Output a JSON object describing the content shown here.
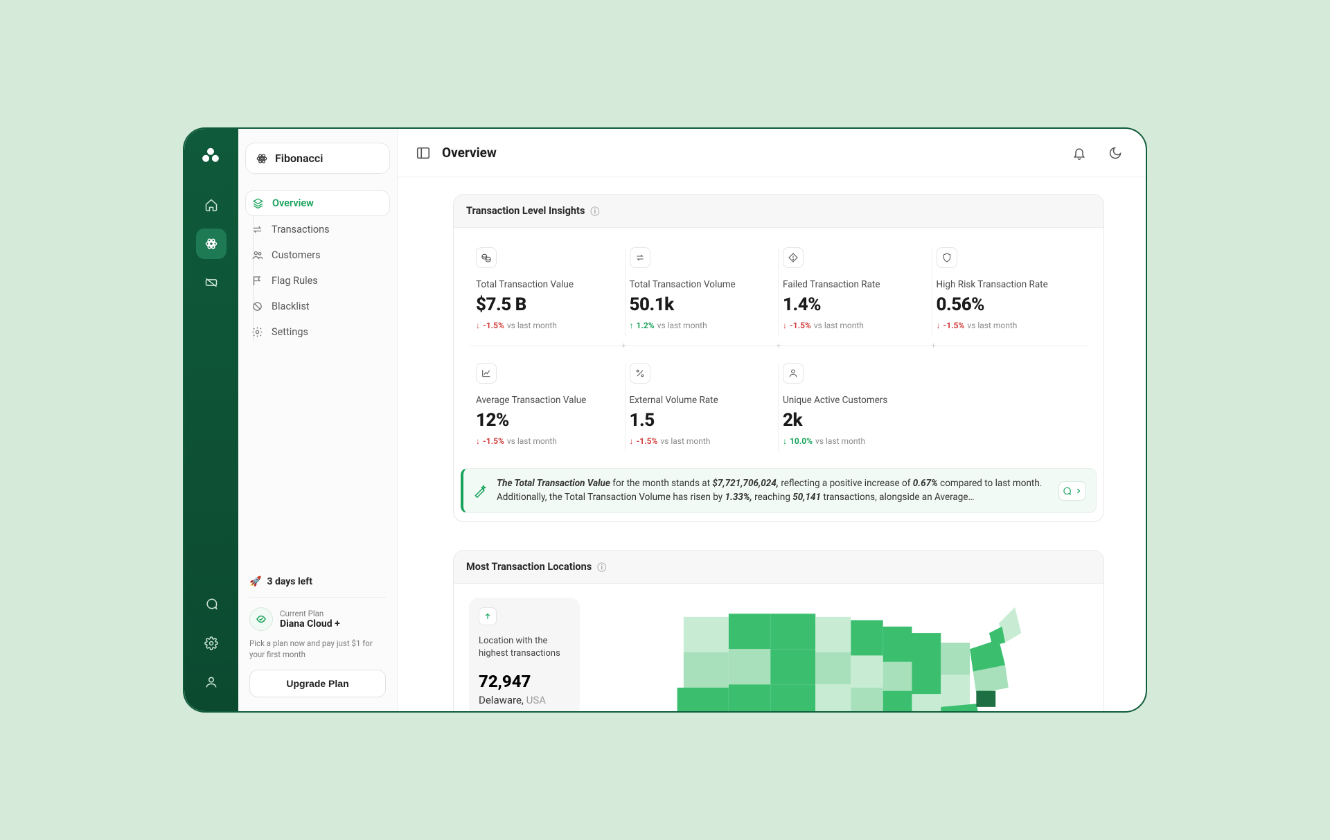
{
  "workspace": {
    "name": "Fibonacci"
  },
  "page": {
    "title": "Overview"
  },
  "sidebar": {
    "items": [
      {
        "label": "Overview"
      },
      {
        "label": "Transactions"
      },
      {
        "label": "Customers"
      },
      {
        "label": "Flag Rules"
      },
      {
        "label": "Blacklist"
      },
      {
        "label": "Settings"
      }
    ]
  },
  "plan": {
    "trial_prefix": "🚀",
    "trial_text": "3 days left",
    "current_label": "Current Plan",
    "current_name": "Diana Cloud +",
    "copy": "Pick a plan now and pay just $1 for your first month",
    "cta": "Upgrade Plan"
  },
  "insights_card": {
    "title": "Transaction Level Insights",
    "metrics": [
      {
        "label": "Total Transaction Value",
        "value": "$7.5 B",
        "delta": "-1.5%",
        "dir": "down",
        "suffix": "vs last month"
      },
      {
        "label": "Total Transaction Volume",
        "value": "50.1k",
        "delta": "1.2%",
        "dir": "up",
        "suffix": "vs last month"
      },
      {
        "label": "Failed Transaction Rate",
        "value": "1.4%",
        "delta": "-1.5%",
        "dir": "down",
        "suffix": "vs last month"
      },
      {
        "label": "High Risk Transaction Rate",
        "value": "0.56%",
        "delta": "-1.5%",
        "dir": "down",
        "suffix": "vs last month"
      },
      {
        "label": "Average Transaction Value",
        "value": "12%",
        "delta": "-1.5%",
        "dir": "down",
        "suffix": "vs last month"
      },
      {
        "label": "External Volume Rate",
        "value": "1.5",
        "delta": "-1.5%",
        "dir": "down",
        "suffix": "vs last month"
      },
      {
        "label": "Unique Active Customers",
        "value": "2k",
        "delta": "10.0%",
        "dir": "up",
        "suffix": "vs last month"
      }
    ],
    "ai": {
      "lead": "The Total Transaction Value",
      "mid1": " for the month stands at ",
      "v1": "$7,721,706,024,",
      "mid2": " reflecting a positive increase of ",
      "v2": "0.67%",
      "mid3": " compared to last month. Additionally, the Total Transaction Volume has risen by ",
      "v3": "1.33%,",
      "mid4": " reaching ",
      "v4": "50,141",
      "tail": " transactions, alongside an Average…"
    }
  },
  "locations_card": {
    "title": "Most Transaction Locations",
    "highlight": {
      "caption": "Location with the highest transactions",
      "value": "72,947",
      "city": "Delaware,",
      "country": "USA"
    }
  }
}
